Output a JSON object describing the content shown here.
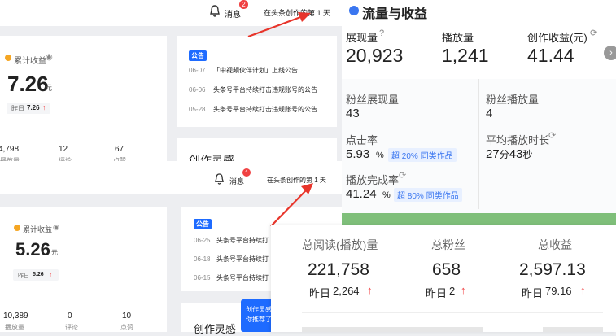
{
  "top": {
    "notif_label": "消息",
    "notif_count": "2",
    "days_text": "在头条创作的第 1 天",
    "earnings": {
      "label": "累计收益",
      "value": "7.26",
      "unit": "元",
      "yesterday_label": "昨日",
      "yesterday_value": "7.26"
    },
    "stats": [
      {
        "value": "4,798",
        "label": "播放量"
      },
      {
        "value": "12",
        "label": "评论"
      },
      {
        "value": "67",
        "label": "点赞"
      }
    ],
    "announcement": {
      "tag": "公告",
      "items": [
        {
          "date": "06-07",
          "text": "「中视频伙伴计划」上线公告"
        },
        {
          "date": "06-06",
          "text": "头条号平台持续打击违规账号的公告"
        },
        {
          "date": "05-28",
          "text": "头条号平台持续打击违规账号的公告"
        }
      ]
    },
    "inspiration_title": "创作灵感"
  },
  "mid": {
    "notif_label": "消息",
    "notif_count": "4",
    "days_text": "在头条创作的第 1 天",
    "earnings": {
      "label": "累计收益",
      "value": "5.26",
      "unit": "元",
      "yesterday_label": "昨日",
      "yesterday_value": "5.26"
    },
    "stats": [
      {
        "value": "10,389",
        "label": "播放量"
      },
      {
        "value": "0",
        "label": "评论"
      },
      {
        "value": "10",
        "label": "点赞"
      }
    ],
    "announcement": {
      "tag": "公告",
      "items": [
        {
          "date": "06-25",
          "text": "头条号平台持续打"
        },
        {
          "date": "06-18",
          "text": "头条号平台持续打"
        },
        {
          "date": "06-15",
          "text": "头条号平台持续打"
        }
      ]
    },
    "inspiration_title": "创作灵感",
    "popup_lines": [
      "创作灵感",
      "你推荐了"
    ]
  },
  "traffic": {
    "title": "流量与收益",
    "metrics": [
      {
        "label": "展现量",
        "value": "20,923"
      },
      {
        "label": "播放量",
        "value": "1,241"
      },
      {
        "label": "创作收益(元)",
        "value": "41.44"
      }
    ],
    "fans_impressions": {
      "label": "粉丝展现量",
      "value": "43"
    },
    "fans_plays": {
      "label": "粉丝播放量",
      "value": "4"
    },
    "ctr": {
      "label": "点击率",
      "value": "5.93",
      "unit": "%",
      "pill": "超 20% 同类作品"
    },
    "avg_time": {
      "label": "平均播放时长",
      "min": "27",
      "min_unit": "分",
      "sec": "43",
      "sec_unit": "秒"
    },
    "completion": {
      "label": "播放完成率",
      "value": "41.24",
      "unit": "%",
      "pill": "超 80% 同类作品"
    }
  },
  "totals": {
    "cols": [
      {
        "label": "总阅读(播放)量",
        "value": "221,758",
        "y_label": "昨日",
        "y_value": "2,264"
      },
      {
        "label": "总粉丝",
        "value": "658",
        "y_label": "昨日",
        "y_value": "2"
      },
      {
        "label": "总收益",
        "value": "2,597.13",
        "y_label": "昨日",
        "y_value": "79.16"
      }
    ]
  },
  "colors": {
    "accent_blue": "#1e6bff",
    "up_red": "#f04142",
    "arrow_red": "#e8352b",
    "grass_green": "#7fbf7a"
  }
}
